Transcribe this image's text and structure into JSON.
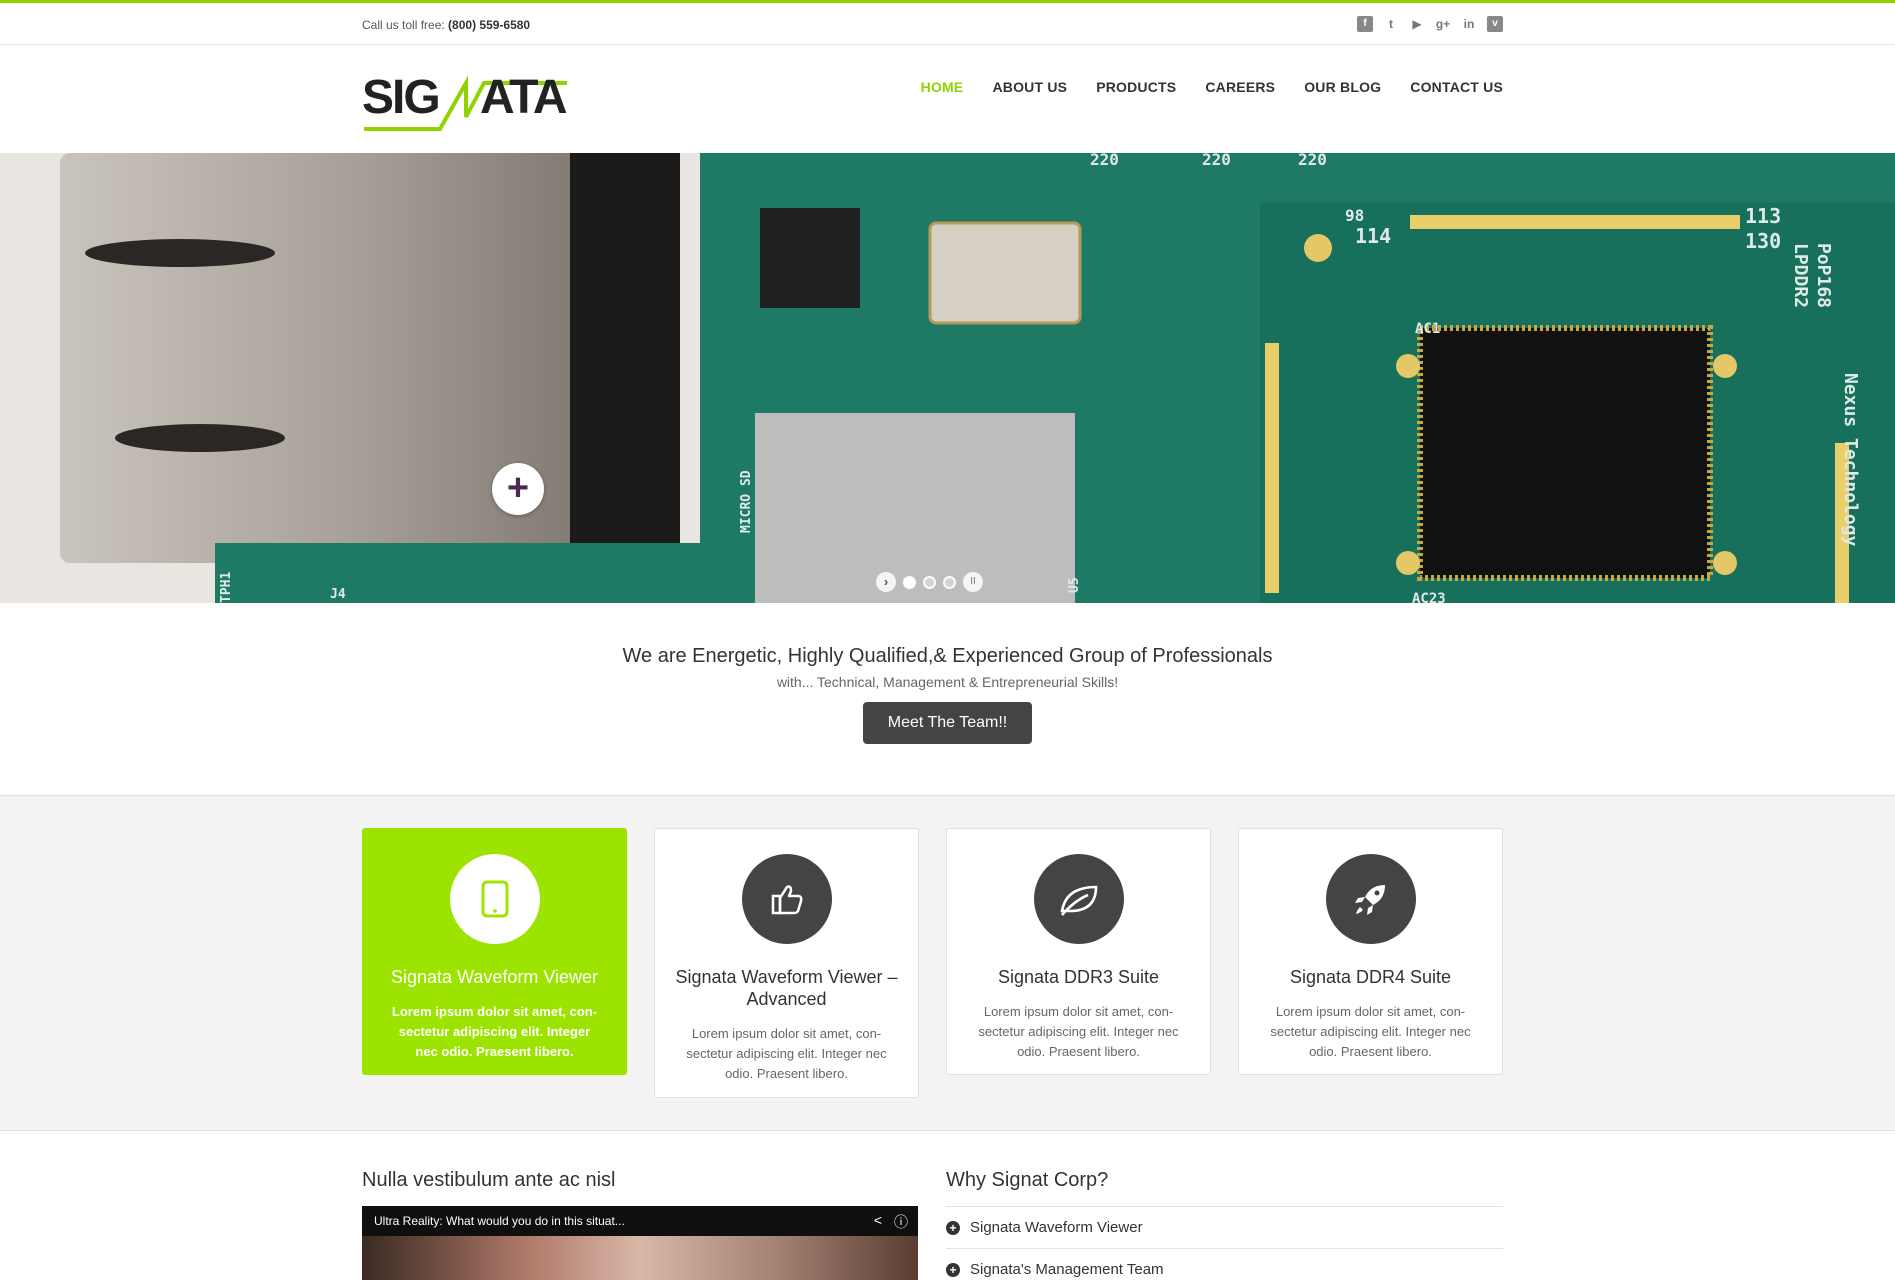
{
  "topbar": {
    "call_label": "Call us toll free:",
    "phone": "(800) 559-6580",
    "social_icons": [
      "facebook-icon",
      "twitter-icon",
      "youtube-icon",
      "google-plus-icon",
      "linkedin-icon",
      "vimeo-icon"
    ]
  },
  "brand": {
    "logo_text_left": "SIG",
    "logo_text_right": "ATA",
    "accent_color": "#8fd400"
  },
  "nav": {
    "items": [
      {
        "label": "HOME",
        "active": true
      },
      {
        "label": "ABOUT US"
      },
      {
        "label": "PRODUCTS"
      },
      {
        "label": "CAREERS"
      },
      {
        "label": "OUR BLOG"
      },
      {
        "label": "CONTACT US"
      }
    ]
  },
  "hero": {
    "plus_symbol": "+",
    "slider_prev": "›",
    "slider_pause": "II",
    "slides_count": 3,
    "active_slide": 1,
    "pcb_labels": [
      "220",
      "220",
      "220",
      "98",
      "114",
      "113",
      "130",
      "LPDDR2",
      "PoP168",
      "MICRO SD",
      "Nexus Technology",
      "AC1",
      "AC23",
      "U5",
      "TPH1",
      "J4"
    ]
  },
  "intro": {
    "heading": "We are Energetic, Highly Qualified,& Experienced Group of Professionals",
    "subheading": "with... Technical, Management & Entrepreneurial Skills!",
    "button": "Meet The Team!!"
  },
  "services": {
    "cards": [
      {
        "title": "Signata Waveform Viewer",
        "text": "Lorem ipsum dolor sit amet, con-sectetur adipiscing elit. Integer nec odio. Praesent libero.",
        "icon": "tablet-icon"
      },
      {
        "title": "Signata Waveform Viewer – Advanced",
        "text": "Lorem ipsum dolor sit amet, con-sectetur adipiscing elit. Integer nec odio. Praesent libero.",
        "icon": "thumbs-up-icon"
      },
      {
        "title": "Signata DDR3 Suite",
        "text": "Lorem ipsum dolor sit amet, con-sectetur adipiscing elit. Integer nec odio. Praesent libero.",
        "icon": "leaf-icon"
      },
      {
        "title": "Signata DDR4 Suite",
        "text": "Lorem ipsum dolor sit amet, con-sectetur adipiscing elit. Integer nec odio. Praesent libero.",
        "icon": "rocket-icon"
      }
    ]
  },
  "bottom": {
    "left_heading": "Nulla vestibulum ante ac nisl",
    "video_title": "Ultra Reality: What would you do in this situat...",
    "right_heading": "Why Signat Corp?",
    "accordion": [
      {
        "label": "Signata Waveform Viewer",
        "symbol": "+"
      },
      {
        "label": "Signata's Management Team",
        "symbol": "+"
      }
    ]
  }
}
